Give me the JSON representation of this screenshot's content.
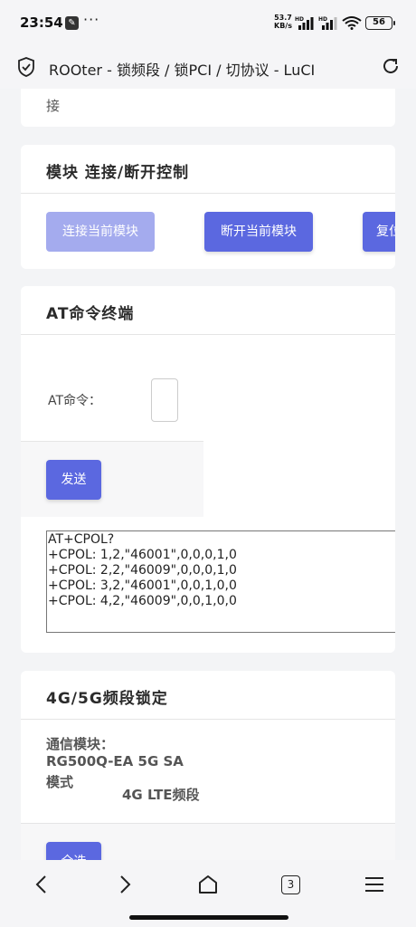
{
  "statusbar": {
    "time": "23:54",
    "dots": "···",
    "net_speed_value": "53.7",
    "net_speed_unit": "KB/s",
    "hd1": "HD",
    "hd2": "HD",
    "battery": "56"
  },
  "urlbar": {
    "title": "ROOter - 锁频段 / 锁PCI / 切协议 - LuCI"
  },
  "top_card": {
    "fragment": "接"
  },
  "module_card": {
    "title": "模块 连接/断开控制",
    "connect_label": "连接当前模块",
    "disconnect_label": "断开当前模块",
    "reset_label": "复位"
  },
  "at_card": {
    "title": "AT命令终端",
    "command_label": "AT命令：",
    "send_label": "发送",
    "output": [
      "AT+CPOL?",
      "+CPOL: 1,2,\"46001\",0,0,0,1,0",
      "+CPOL: 2,2,\"46009\",0,0,0,1,0",
      "+CPOL: 3,2,\"46001\",0,0,1,0,0",
      "+CPOL: 4,2,\"46009\",0,0,1,0,0"
    ]
  },
  "band_card": {
    "title": "4G/5G频段锁定",
    "module_label": "通信模块：",
    "module_value": "RG500Q-EA 5G SA",
    "mode_label": "模式",
    "band_label": "4G LTE频段",
    "select_all_label": "全选"
  },
  "navbar": {
    "tab_count": "3"
  }
}
